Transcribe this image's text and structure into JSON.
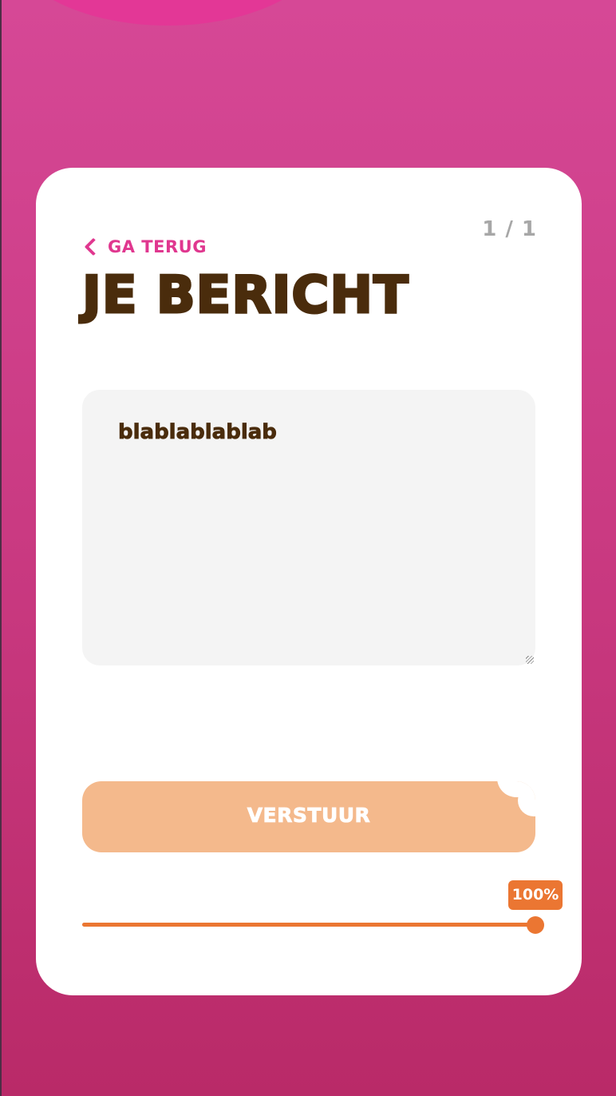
{
  "header": {
    "page_indicator": "1 / 1",
    "back_label": "GA TERUG",
    "title": "JE BERICHT"
  },
  "message": {
    "value": "blablablablab"
  },
  "send_button": {
    "label": "VERSTUUR"
  },
  "progress": {
    "label": "100%",
    "fraction": 1.0
  },
  "icons": {
    "back": "chevron-left-icon"
  },
  "colors": {
    "accent_pink": "#e0378f",
    "title_brown": "#4a2c0c",
    "button_peach": "#f4b98c",
    "progress_orange": "#eb7632",
    "card_white": "#ffffff",
    "field_gray": "#f4f4f4",
    "indicator_gray": "#a7a7a7"
  }
}
